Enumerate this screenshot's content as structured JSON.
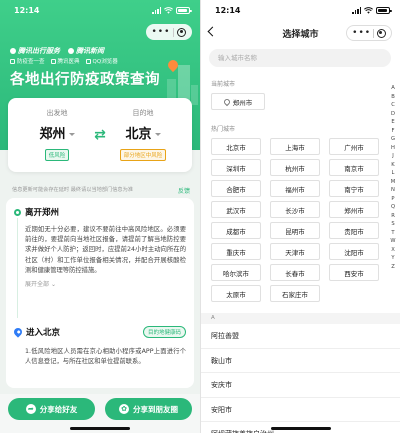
{
  "colors": {
    "brand": "#2bb87a",
    "low_risk": "#2bb87a",
    "mid_risk": "#e8a317",
    "location": "#2f7cf6"
  },
  "left": {
    "status": {
      "time": "12:14"
    },
    "brand": {
      "tencent_travel": "腾讯出行服务",
      "tencent_news": "腾讯新闻"
    },
    "services": [
      "防疫查一查",
      "腾讯医典",
      "QQ浏览器"
    ],
    "title": "各地出行防疫政策查询",
    "route": {
      "from_label": "出发地",
      "from_city": "郑州",
      "from_risk": "低风险",
      "to_label": "目的地",
      "to_city": "北京",
      "to_risk": "部分地区中风险"
    },
    "notice": "信息更新可能会存在延时 最终请以当地部门信息为准",
    "feedback": "反馈",
    "leave": {
      "title": "离开郑州",
      "text": "近期如无十分必要，建议不要前往中高风险地区。必须要前往的，要提前向当地社区报备，请提前了解当地防控要求并做好个人防护；返回时，应提前24小时主动向所在的社区（村）和工作单位报备相关情况，并配合开展核酸检测和健康管理等防控措施。",
      "expand": "展开全部"
    },
    "enter": {
      "title": "进入北京",
      "tag": "目的地健康码",
      "text": "1.低风险地区人员需在京心相助小程序或APP上面进行个人信息登记，与所在社区和单位提前联系。"
    },
    "share_friend": "分享给好友",
    "share_moments": "分享到朋友圈"
  },
  "right": {
    "status": {
      "time": "12:14"
    },
    "title": "选择城市",
    "search_placeholder": "输入城市名称",
    "current_label": "当前城市",
    "current_city": "郑州市",
    "hot_label": "热门城市",
    "hot_cities": [
      "北京市",
      "上海市",
      "广州市",
      "深圳市",
      "杭州市",
      "南京市",
      "合肥市",
      "福州市",
      "南宁市",
      "武汉市",
      "长沙市",
      "郑州市",
      "成都市",
      "昆明市",
      "贵阳市",
      "重庆市",
      "天津市",
      "沈阳市",
      "哈尔滨市",
      "长春市",
      "西安市",
      "太原市",
      "石家庄市"
    ],
    "index_letters": [
      "A",
      "B",
      "C",
      "D",
      "E",
      "F",
      "G",
      "H",
      "J",
      "K",
      "L",
      "M",
      "N",
      "P",
      "Q",
      "R",
      "S",
      "T",
      "W",
      "X",
      "Y",
      "Z"
    ],
    "group_letter": "A",
    "list": [
      "阿拉善盟",
      "鞍山市",
      "安庆市",
      "安阳市",
      "阿坝藏族羌族自治州"
    ]
  }
}
